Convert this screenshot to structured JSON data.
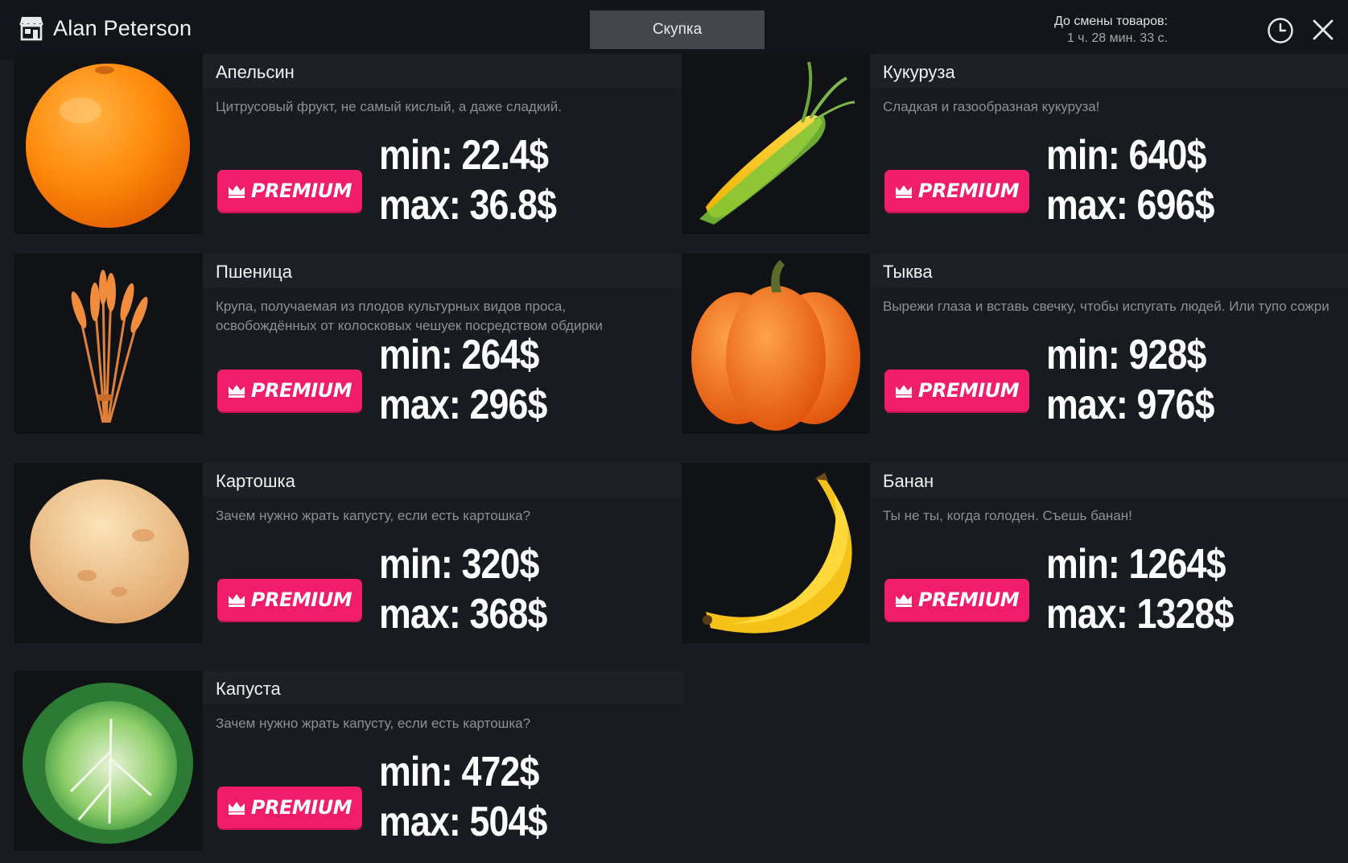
{
  "header": {
    "user_name": "Alan Peterson",
    "tab_label": "Скупка",
    "timer_label": "До смены товаров:",
    "timer_value": "1 ч. 28 мин. 33 с."
  },
  "colors": {
    "background": "#181c21",
    "header": "#12151a",
    "premium": "#f21d6a"
  },
  "items": [
    {
      "name": "Апельсин",
      "description": "Цитрусовый фрукт, не самый кислый, а даже сладкий.",
      "badge": "PREMIUM",
      "min": "min: 22.4$",
      "max": "max: 36.8$",
      "icon": "orange-image"
    },
    {
      "name": "Кукуруза",
      "description": "Сладкая и газообразная кукуруза!",
      "badge": "PREMIUM",
      "min": "min: 640$",
      "max": "max: 696$",
      "icon": "corn-image"
    },
    {
      "name": "Пшеница",
      "description": "Крупа, получаемая из плодов культурных видов проса, освобождённых от колосковых чешуек посредством обдирки",
      "badge": "PREMIUM",
      "min": "min: 264$",
      "max": "max: 296$",
      "icon": "wheat-image"
    },
    {
      "name": "Тыква",
      "description": "Вырежи глаза и вставь свечку, чтобы испугать людей. Или тупо сожри",
      "badge": "PREMIUM",
      "min": "min: 928$",
      "max": "max: 976$",
      "icon": "pumpkin-image"
    },
    {
      "name": "Картошка",
      "description": "Зачем нужно жрать капусту, если есть картошка?",
      "badge": "PREMIUM",
      "min": "min: 320$",
      "max": "max: 368$",
      "icon": "potato-image"
    },
    {
      "name": "Банан",
      "description": "Ты не ты, когда голоден. Съешь банан!",
      "badge": "PREMIUM",
      "min": "min: 1264$",
      "max": "max: 1328$",
      "icon": "banana-image"
    },
    {
      "name": "Капуста",
      "description": "Зачем нужно жрать капусту, если есть картошка?",
      "badge": "PREMIUM",
      "min": "min: 472$",
      "max": "max: 504$",
      "icon": "cabbage-image"
    }
  ]
}
